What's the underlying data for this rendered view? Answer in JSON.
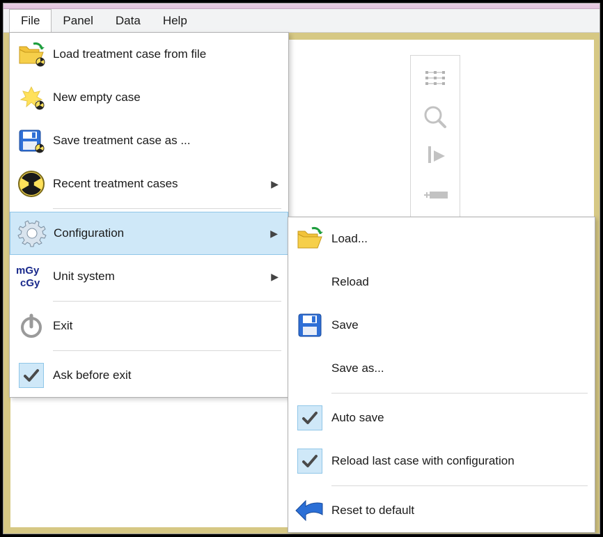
{
  "menubar": {
    "items": [
      "File",
      "Panel",
      "Data",
      "Help"
    ],
    "open_index": 0
  },
  "file_menu": {
    "items": [
      {
        "label": "Load treatment case from file",
        "icon": "folder-open-rad",
        "submenu": false,
        "checked": false
      },
      {
        "label": "New empty case",
        "icon": "sun-rad",
        "submenu": false,
        "checked": false
      },
      {
        "label": "Save treatment case as ...",
        "icon": "floppy-rad",
        "submenu": false,
        "checked": false
      },
      {
        "label": "Recent treatment cases",
        "icon": "radiation",
        "submenu": true,
        "checked": false
      },
      {
        "label": "Configuration",
        "icon": "gear",
        "submenu": true,
        "checked": false,
        "highlighted": true
      },
      {
        "label": "Unit system",
        "icon": "mgy-cgy",
        "submenu": true,
        "checked": false
      },
      {
        "label": "Exit",
        "icon": "power",
        "submenu": false,
        "checked": false
      },
      {
        "label": "Ask before exit",
        "icon": "check",
        "submenu": false,
        "checked": true
      }
    ],
    "separators_after": [
      3,
      5,
      6
    ]
  },
  "config_submenu": {
    "items": [
      {
        "label": "Load...",
        "icon": "folder-open",
        "checked": false
      },
      {
        "label": "Reload",
        "icon": "",
        "checked": false
      },
      {
        "label": "Save",
        "icon": "floppy",
        "checked": false
      },
      {
        "label": "Save as...",
        "icon": "",
        "checked": false
      },
      {
        "label": "Auto save",
        "icon": "check",
        "checked": true
      },
      {
        "label": "Reload last case with configuration",
        "icon": "check",
        "checked": true
      },
      {
        "label": "Reset to default",
        "icon": "reset-arrow",
        "checked": false
      }
    ],
    "separators_after": [
      3,
      5
    ]
  },
  "right_tools": {
    "items": [
      "grid-tool",
      "zoom-tool",
      "edit-tool",
      "slider-tool"
    ]
  }
}
